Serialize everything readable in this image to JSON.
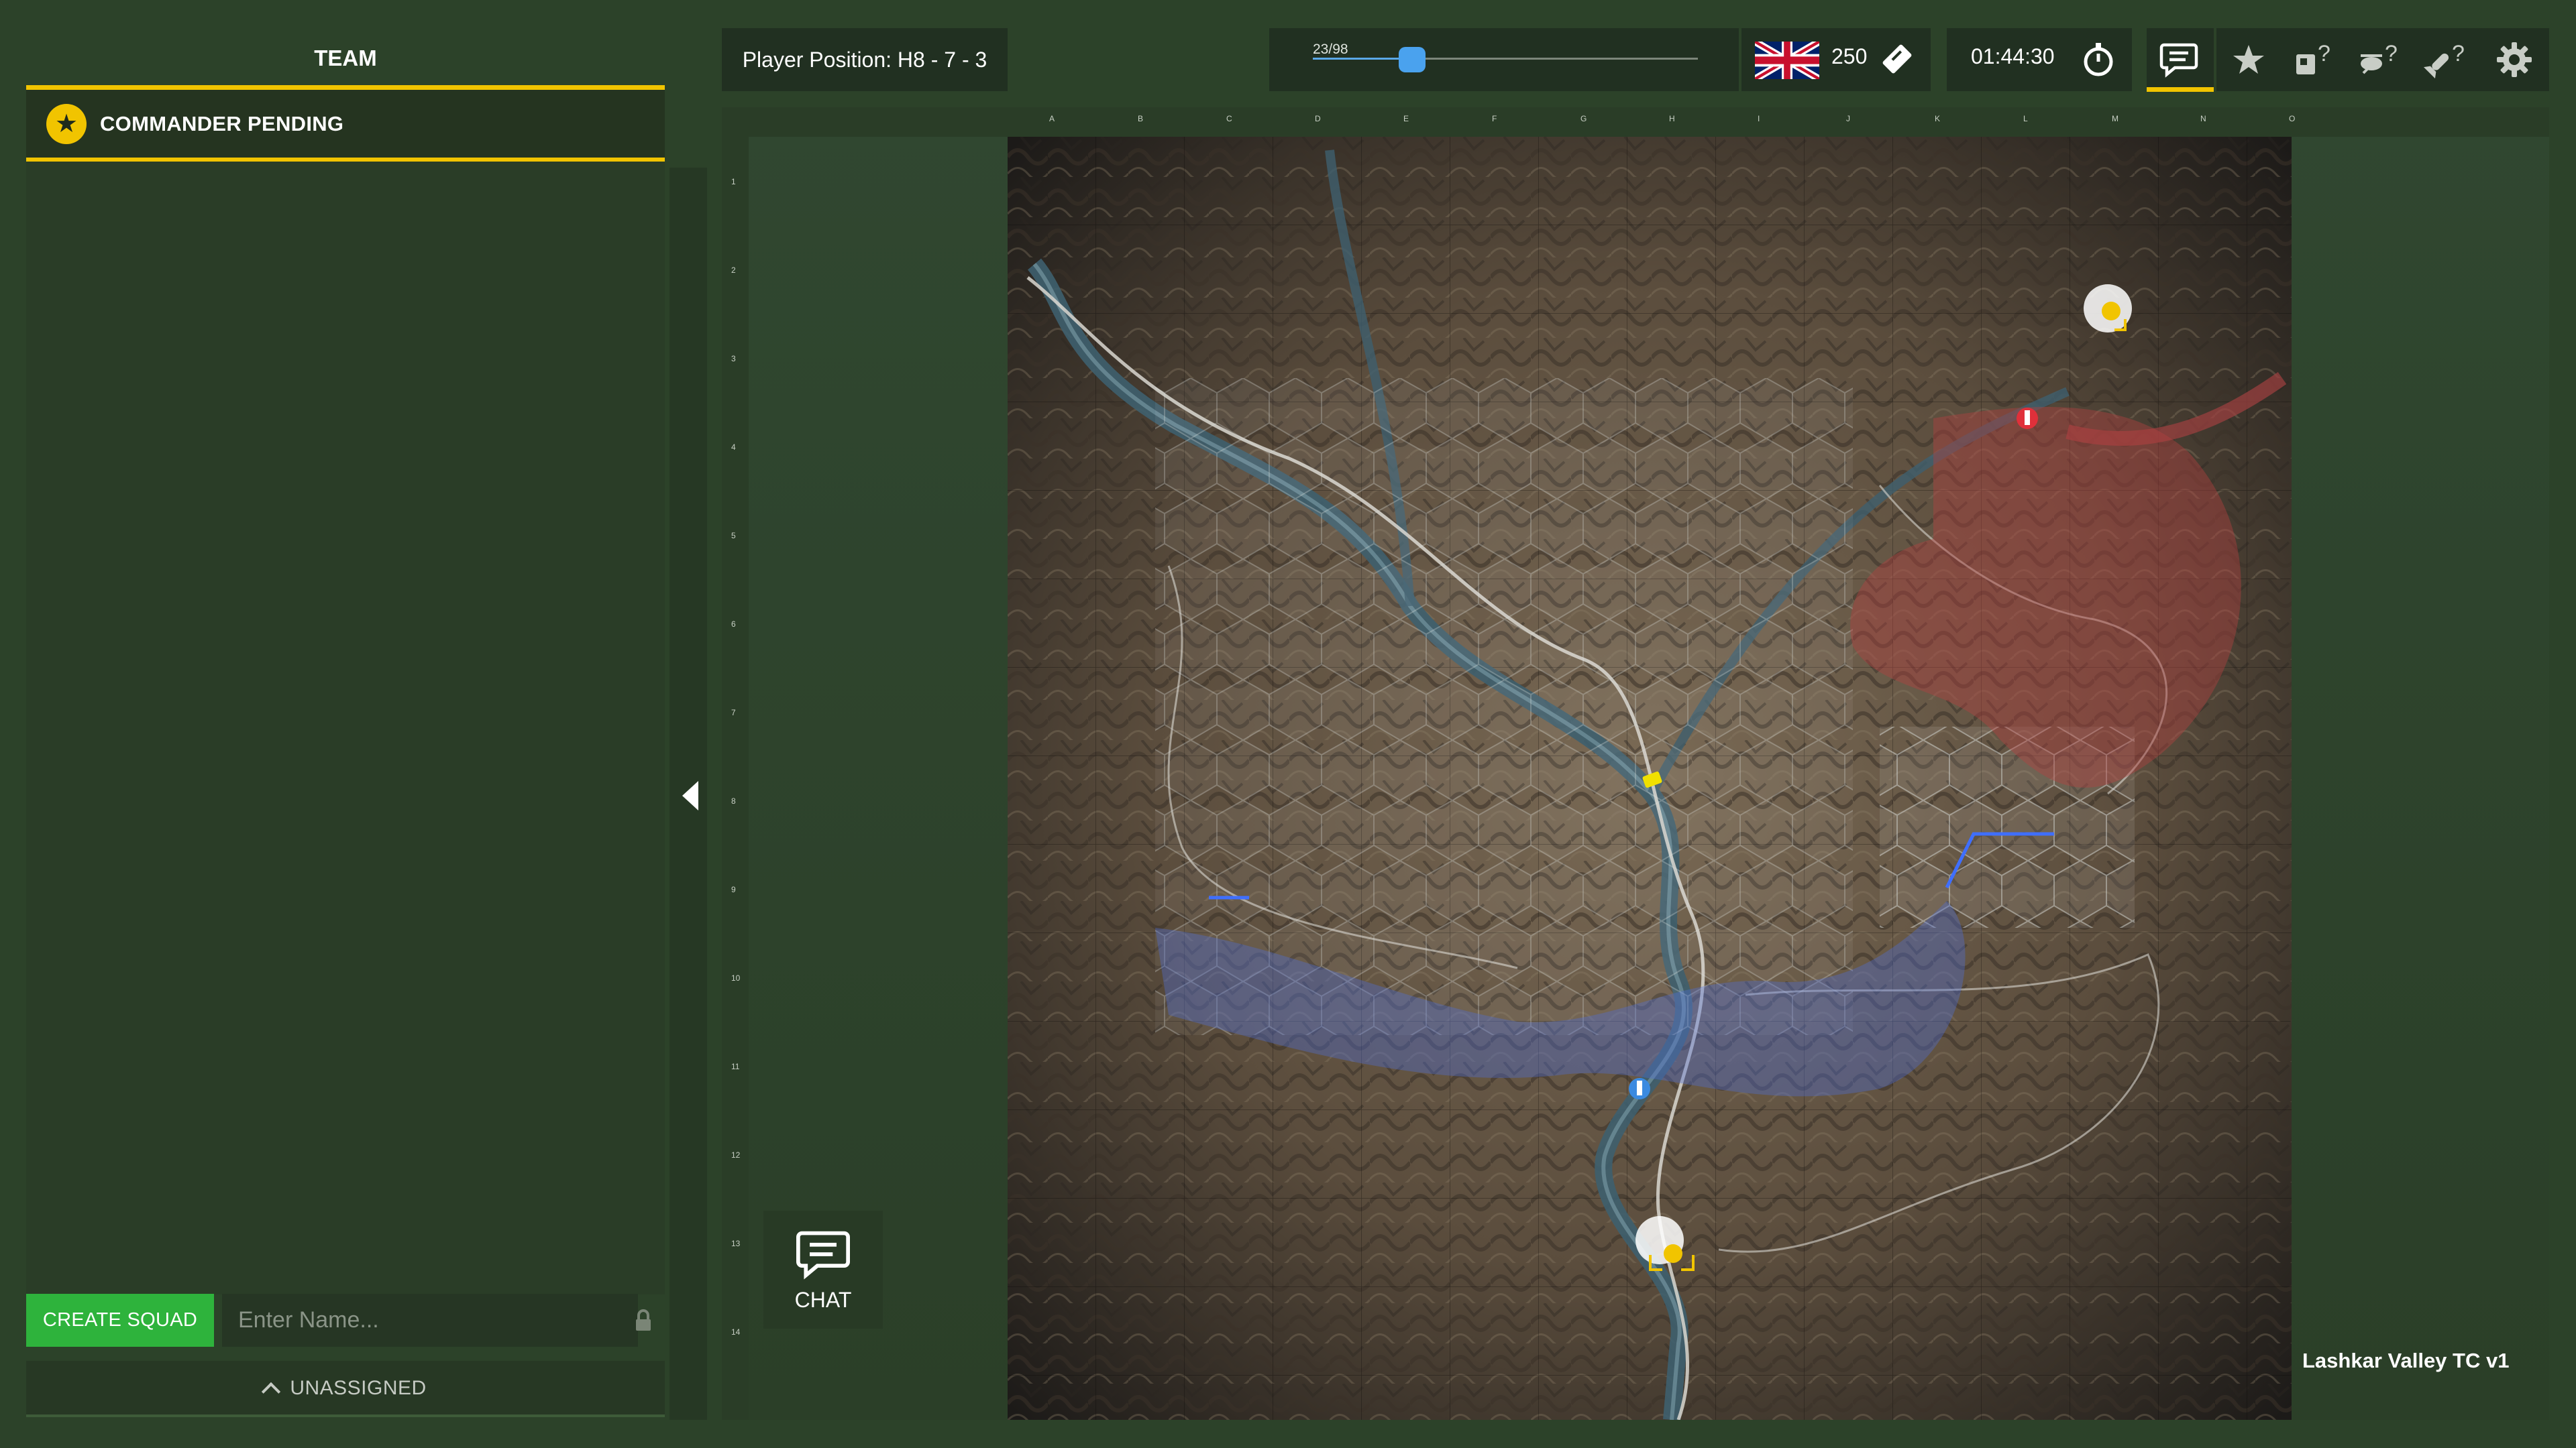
{
  "team_panel": {
    "header": "TEAM",
    "commander_label": "COMMANDER PENDING",
    "commander_icon": "star-icon",
    "create_squad_label": "CREATE SQUAD",
    "squad_name_placeholder": "Enter Name...",
    "unassigned_label": "UNASSIGNED"
  },
  "top_bar": {
    "player_position": "Player Position: H8 - 7 - 3",
    "slider_label": "23/98",
    "slider_value": 23,
    "slider_max": 98,
    "faction_flag": "uk-flag",
    "tickets": "250",
    "timer": "01:44:30",
    "icons": [
      "chat-icon",
      "star-icon",
      "squad-help-icon",
      "vehicle-help-icon",
      "weapon-help-icon",
      "gear-icon"
    ]
  },
  "map": {
    "name": "Lashkar Valley TC v1",
    "columns": [
      "A",
      "B",
      "C",
      "D",
      "E",
      "F",
      "G",
      "H",
      "I",
      "J",
      "K",
      "L",
      "M",
      "N",
      "O"
    ],
    "rows": [
      "1",
      "2",
      "3",
      "4",
      "5",
      "6",
      "7",
      "8",
      "9",
      "10",
      "11",
      "12",
      "13",
      "14"
    ]
  },
  "chat_button": {
    "label": "CHAT"
  },
  "colors": {
    "accent_yellow": "#f1c400",
    "create_squad_green": "#2eb33c",
    "slider_blue": "#4aa2ee",
    "red_team": "#c0393b",
    "blue_team": "#4f6fd6"
  }
}
